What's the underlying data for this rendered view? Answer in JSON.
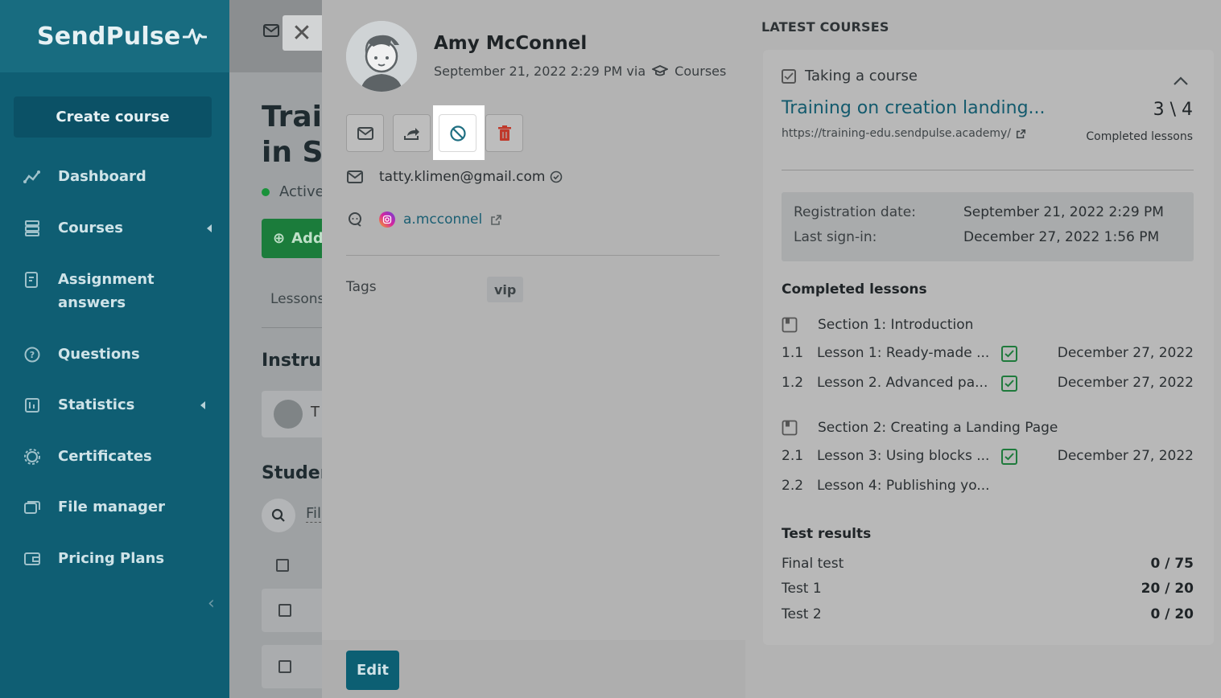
{
  "app": {
    "logo": "SendPulse"
  },
  "sidebar": {
    "create_button": "Create course",
    "items": [
      {
        "label": "Dashboard",
        "icon": "chart-line-icon"
      },
      {
        "label": "Courses",
        "icon": "layers-icon"
      },
      {
        "label": "Assignment answers",
        "icon": "assignment-icon"
      },
      {
        "label": "Questions",
        "icon": "question-bubble-icon"
      },
      {
        "label": "Statistics",
        "icon": "statistics-icon"
      },
      {
        "label": "Certificates",
        "icon": "certificate-icon"
      },
      {
        "label": "File manager",
        "icon": "folder-icon"
      },
      {
        "label": "Pricing Plans",
        "icon": "wallet-icon"
      }
    ]
  },
  "background_page": {
    "title_line1": "Trai",
    "title_line2": "in Se",
    "status": "Active",
    "add_button": "Add",
    "tab_lessons": "Lessons",
    "instructors_heading": "Instruc",
    "instructor_initial": "T",
    "students_heading": "Studen",
    "filter_label": "Fil"
  },
  "profile": {
    "name": "Amy McConnel",
    "registered": "September 21, 2022 2:29 PM via",
    "source": "Courses",
    "email": "tatty.klimen@gmail.com",
    "instagram": "a.mcconnel",
    "tags_label": "Tags",
    "tags": [
      "vip"
    ],
    "edit_button": "Edit"
  },
  "latest_courses": {
    "title": "LATEST COURSES",
    "status": "Taking a course",
    "course_title": "Training on creation landing...",
    "course_url": "https://training-edu.sendpulse.academy/",
    "progress": "3 \\ 4",
    "progress_label": "Completed lessons",
    "registration_label": "Registration date:",
    "registration_value": "September 21, 2022 2:29 PM",
    "last_signin_label": "Last sign-in:",
    "last_signin_value": "December 27, 2022 1:56 PM",
    "completed_heading": "Completed lessons",
    "sections": [
      {
        "title": "Section 1: Introduction",
        "lessons": [
          {
            "num": "1.1",
            "name": "Lesson 1: Ready-made ...",
            "done": true,
            "date": "December 27, 2022"
          },
          {
            "num": "1.2",
            "name": "Lesson 2. Advanced pa...",
            "done": true,
            "date": "December 27, 2022"
          }
        ]
      },
      {
        "title": "Section 2: Creating a Landing Page",
        "lessons": [
          {
            "num": "2.1",
            "name": "Lesson 3: Using blocks ...",
            "done": true,
            "date": "December 27, 2022"
          },
          {
            "num": "2.2",
            "name": "Lesson 4: Publishing yo...",
            "done": false,
            "date": ""
          }
        ]
      }
    ],
    "tests_heading": "Test results",
    "tests": [
      {
        "name": "Final test",
        "score": "0 / 75"
      },
      {
        "name": "Test 1",
        "score": "20 / 20"
      },
      {
        "name": "Test 2",
        "score": "0 / 20"
      }
    ]
  }
}
